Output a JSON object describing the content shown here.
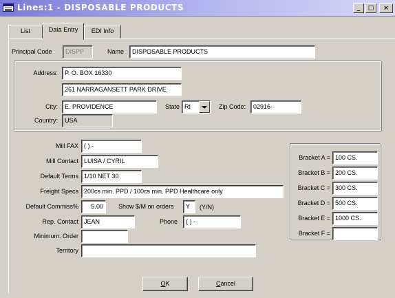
{
  "window": {
    "title": "Lines:1 - DISPOSABLE PRODUCTS",
    "minimize": "_",
    "maximize": "□",
    "close": "×"
  },
  "tabs": [
    {
      "label": "List",
      "active": false
    },
    {
      "label": "Data Entry",
      "active": true
    },
    {
      "label": "EDI Info",
      "active": false
    }
  ],
  "form": {
    "principal_code_label": "Principal Code",
    "principal_code": "DISPP",
    "name_label": "Name",
    "name": "DISPOSABLE PRODUCTS",
    "address_label": "Address:",
    "address1": "P. O. BOX 16330",
    "address2": "261 NARRAGANSETT PARK DRIVE",
    "city_label": "City:",
    "city": "E. PROVIDENCE",
    "state_label": "State",
    "state": "RI",
    "zip_label": "Zip Code:",
    "zip": "02916-",
    "country_label": "Country:",
    "country": "USA",
    "mill_fax_label": "Mill FAX",
    "mill_fax": "(  )   -",
    "mill_contact_label": "Mill Contact",
    "mill_contact": "LUISA / CYRIL",
    "default_terms_label": "Default Terms",
    "default_terms": "1/10 NET 30",
    "freight_specs_label": "Freight Specs",
    "freight_specs": "200cs min. PPD  / 100cs min. PPD Healthcare only",
    "default_commiss_label": "Default Commiss%",
    "default_commiss": "5.00",
    "show_m_label": "Show $/M on orders",
    "show_m": "Y",
    "yn_hint": "(Y/N)",
    "rep_contact_label": "Rep. Contact",
    "rep_contact": "JEAN",
    "phone_label": "Phone",
    "phone": "(  )   -",
    "min_order_label": "Minimum. Order",
    "min_order": "",
    "territory_label": "Territory",
    "territory": ""
  },
  "brackets": [
    {
      "label": "Bracket A =",
      "value": "100 CS."
    },
    {
      "label": "Bracket B =",
      "value": "200 CS."
    },
    {
      "label": "Bracket C =",
      "value": "300 CS."
    },
    {
      "label": "Bracket D =",
      "value": "500 CS."
    },
    {
      "label": "Bracket E =",
      "value": "1000 CS."
    },
    {
      "label": "Bracket F =",
      "value": ""
    }
  ],
  "buttons": {
    "ok_mnemonic": "O",
    "ok_rest": "K",
    "cancel_mnemonic": "C",
    "cancel_rest": "ancel"
  }
}
